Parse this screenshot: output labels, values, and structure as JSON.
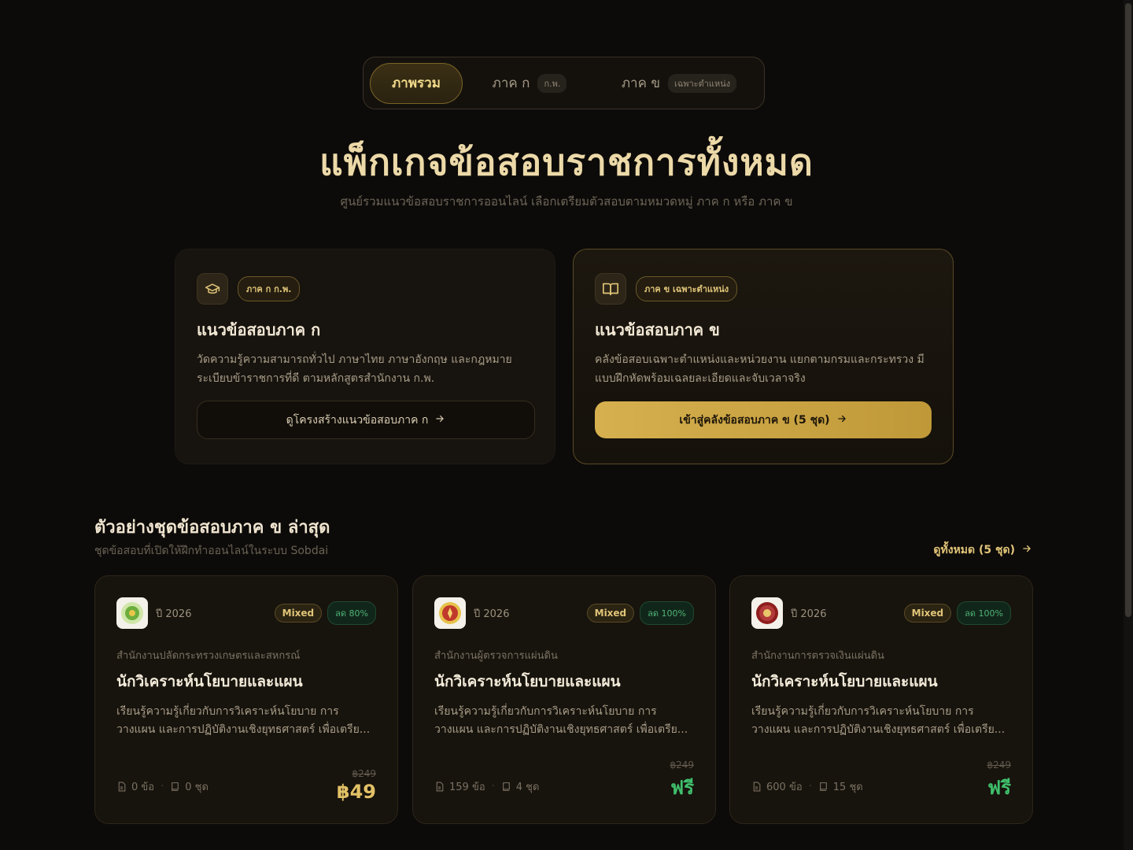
{
  "tabs": {
    "overview": "ภาพรวม",
    "part_a": "ภาค ก",
    "part_a_pill": "ก.พ.",
    "part_b": "ภาค ข",
    "part_b_pill": "เฉพาะตำแหน่ง"
  },
  "hero": {
    "title": "แพ็กเกจข้อสอบราชการทั้งหมด",
    "subtitle": "ศูนย์รวมแนวข้อสอบราชการออนไลน์ เลือกเตรียมตัวสอบตามหมวดหมู่ ภาค ก หรือ ภาค ข"
  },
  "part_a_card": {
    "icon": "graduation-cap-icon",
    "badge": "ภาค ก ก.พ.",
    "title": "แนวข้อสอบภาค ก",
    "desc_line1": "วัดความรู้ความสามารถทั่วไป ภาษาไทย ภาษาอังกฤษ และกฎหมาย",
    "desc_line2": "ระเบียบข้าราชการที่ดี ตามหลักสูตรสำนักงาน ก.พ.",
    "button": "ดูโครงสร้างแนวข้อสอบภาค ก"
  },
  "part_b_card": {
    "icon": "book-open-icon",
    "badge": "ภาค ข เฉพาะตำแหน่ง",
    "title": "แนวข้อสอบภาค ข",
    "desc_line1": "คลังข้อสอบเฉพาะตำแหน่งและหน่วยงาน แยกตามกรมและกระทรวง มี",
    "desc_line2": "แบบฝึกหัดพร้อมเฉลยละเอียดและจับเวลาจริง",
    "button": "เข้าสู่คลังข้อสอบภาค ข (5 ชุด)"
  },
  "section": {
    "title": "ตัวอย่างชุดข้อสอบภาค ข ล่าสุด",
    "subtitle": "ชุดข้อสอบที่เปิดให้ฝึกทำออนไลน์ในระบบ Sobdai",
    "see_all": "ดูทั้งหมด (5 ชุด)"
  },
  "exams": [
    {
      "year": "ปี 2026",
      "type": "Mixed",
      "discount": "ลด 80%",
      "org": "สำนักงานปลัดกระทรวงเกษตรและสหกรณ์",
      "title": "นักวิเคราะห์นโยบายและแผน",
      "desc_line1": "เรียนรู้ความรู้เกี่ยวกับการวิเคราะห์นโยบาย การ",
      "desc_line2": "วางแผน และการปฏิบัติงานเชิงยุทธศาสตร์ เพื่อเตรีย...",
      "questions": "0 ข้อ",
      "sets": "0 ชุด",
      "old_price": "฿249",
      "price": "฿49",
      "logo_color": "#6cae3e"
    },
    {
      "year": "ปี 2026",
      "type": "Mixed",
      "discount": "ลด 100%",
      "org": "สำนักงานผู้ตรวจการแผ่นดิน",
      "title": "นักวิเคราะห์นโยบายและแผน",
      "desc_line1": "เรียนรู้ความรู้เกี่ยวกับการวิเคราะห์นโยบาย การ",
      "desc_line2": "วางแผน และการปฏิบัติงานเชิงยุทธศาสตร์ เพื่อเตรีย...",
      "questions": "159 ข้อ",
      "sets": "4 ชุด",
      "old_price": "฿249",
      "price": "ฟรี",
      "logo_color": "#c0392b"
    },
    {
      "year": "ปี 2026",
      "type": "Mixed",
      "discount": "ลด 100%",
      "org": "สำนักงานการตรวจเงินแผ่นดิน",
      "title": "นักวิเคราะห์นโยบายและแผน",
      "desc_line1": "เรียนรู้ความรู้เกี่ยวกับการวิเคราะห์นโยบาย การ",
      "desc_line2": "วางแผน และการปฏิบัติงานเชิงยุทธศาสตร์ เพื่อเตรีย...",
      "questions": "600 ข้อ",
      "sets": "15 ชุด",
      "old_price": "฿249",
      "price": "ฟรี",
      "logo_color": "#8e1d1d"
    }
  ],
  "colors": {
    "accent_gold": "#e0c478",
    "free_green": "#3fbf6c",
    "background": "#0d0b09"
  }
}
